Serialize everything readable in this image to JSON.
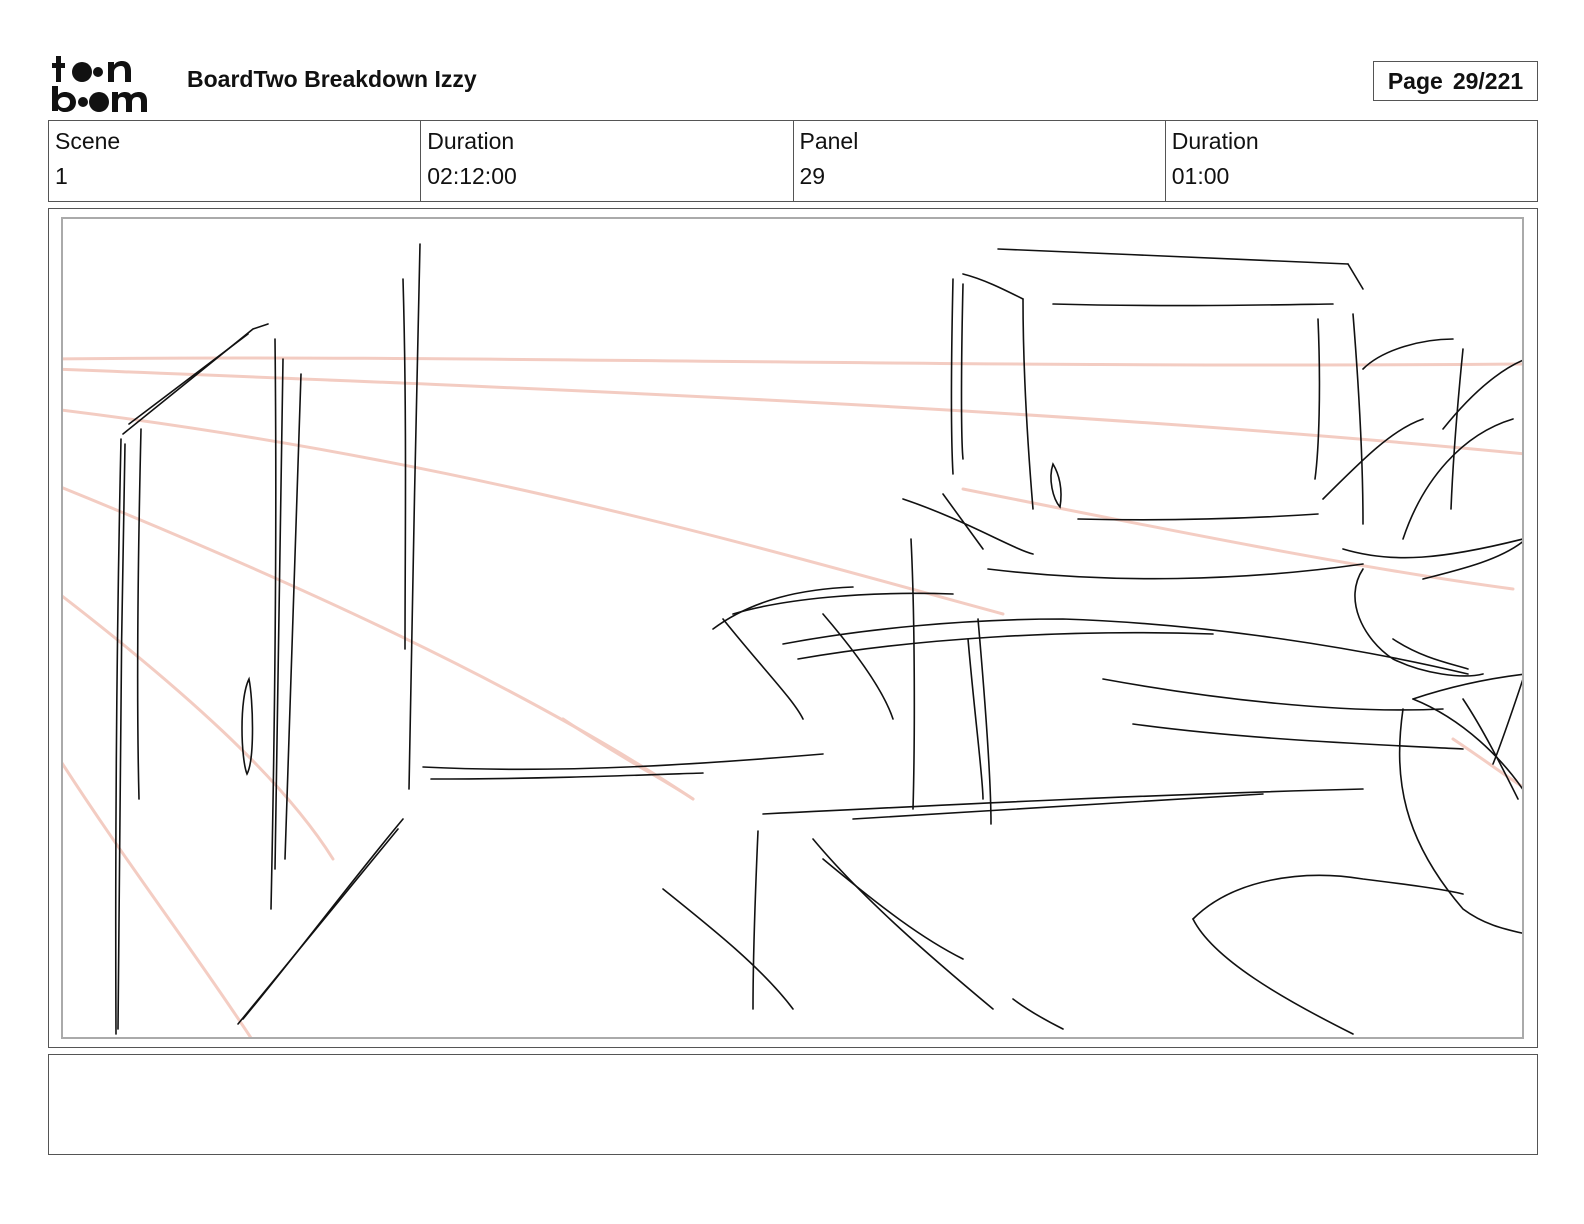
{
  "header": {
    "logo_text": "toon boom",
    "project_title": "BoardTwo Breakdown Izzy",
    "page_label": "Page",
    "page_value": "29/221"
  },
  "info": {
    "scene_label": "Scene",
    "scene_value": "1",
    "scene_duration_label": "Duration",
    "scene_duration_value": "02:12:00",
    "panel_label": "Panel",
    "panel_value": "29",
    "panel_duration_label": "Duration",
    "panel_duration_value": "01:00"
  },
  "panel": {
    "sketch_ink_color": "#111111",
    "perspective_line_color": "#f2c4b8"
  },
  "notes": {
    "text": ""
  }
}
